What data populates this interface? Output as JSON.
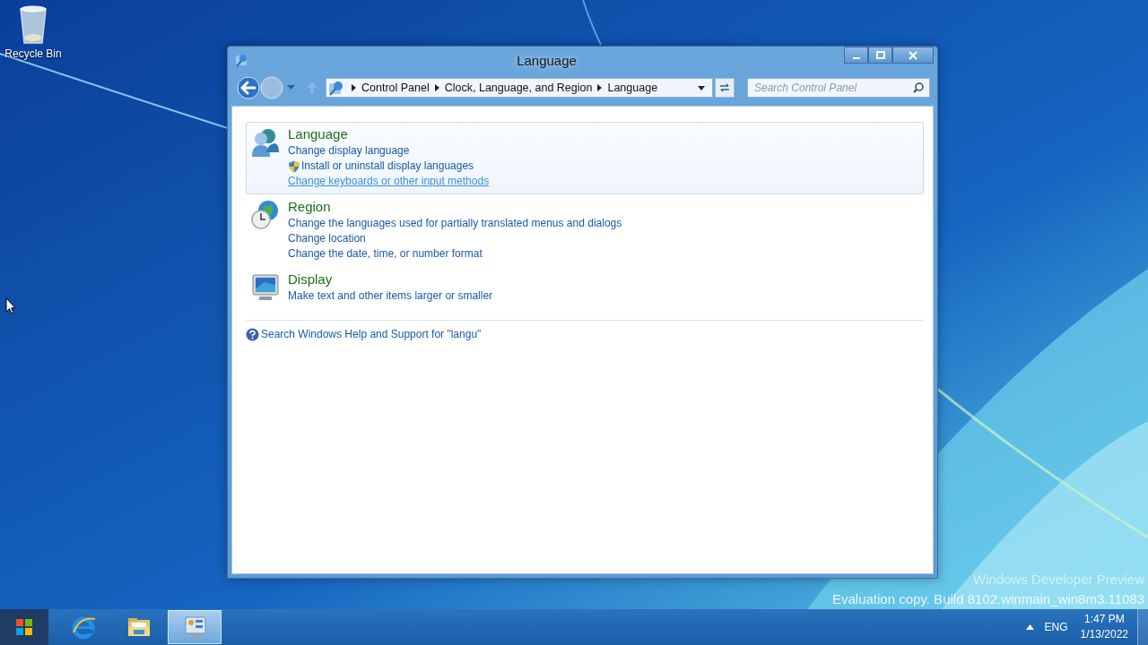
{
  "desktop": {
    "icons": [
      {
        "kind": "recycle-bin",
        "label": "Recycle Bin"
      }
    ],
    "watermark": {
      "line_1": "Windows Developer Preview",
      "line_2": "Evaluation copy. Build 8102.winmain_win8m3.11083"
    }
  },
  "window": {
    "title": "Language",
    "address": {
      "breadcrumbs": [
        "Control Panel",
        "Clock, Language, and Region",
        "Language"
      ]
    },
    "search": {
      "placeholder": "Search Control Panel"
    },
    "categories": [
      {
        "kind": "people",
        "title": "Language",
        "selected": true,
        "links": [
          {
            "text": "Change display language",
            "shield": false,
            "hovered": false
          },
          {
            "text": "Install or uninstall display languages",
            "shield": true,
            "hovered": false
          },
          {
            "text": "Change keyboards or other input methods",
            "shield": false,
            "hovered": true
          }
        ]
      },
      {
        "kind": "globe-clock",
        "title": "Region",
        "selected": false,
        "links": [
          {
            "text": "Change the languages used for partially translated menus and dialogs",
            "shield": false,
            "hovered": false
          },
          {
            "text": "Change location",
            "shield": false,
            "hovered": false
          },
          {
            "text": "Change the date, time, or number format",
            "shield": false,
            "hovered": false
          }
        ]
      },
      {
        "kind": "monitor",
        "title": "Display",
        "selected": false,
        "links": [
          {
            "text": "Make text and other items larger or smaller",
            "shield": false,
            "hovered": false
          }
        ]
      }
    ],
    "help_link": "Search Windows Help and Support for \"langu\""
  },
  "taskbar": {
    "items": [
      {
        "kind": "start",
        "active": false
      },
      {
        "kind": "browser",
        "active": false
      },
      {
        "kind": "folder",
        "active": false
      },
      {
        "kind": "control-panel",
        "active": true
      }
    ],
    "tray": {
      "language": "ENG",
      "time": "1:47 PM",
      "date": "1/13/2022"
    }
  }
}
